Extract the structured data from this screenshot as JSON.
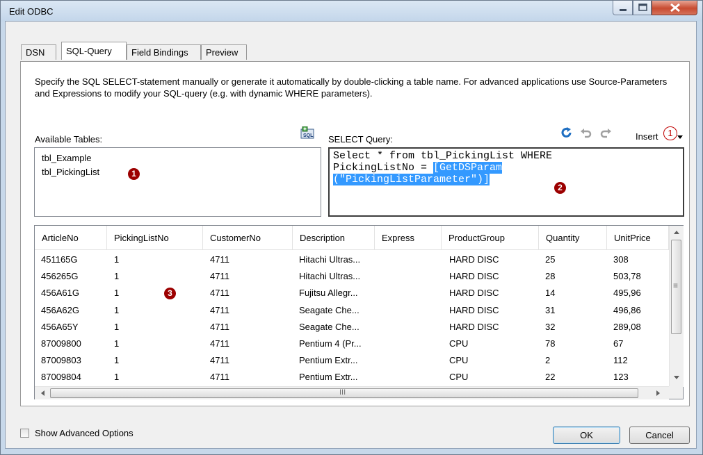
{
  "window": {
    "title": "Edit ODBC"
  },
  "tabs": [
    {
      "label": "DSN"
    },
    {
      "label": "SQL-Query"
    },
    {
      "label": "Field Bindings"
    },
    {
      "label": "Preview"
    }
  ],
  "description": "Specify the SQL SELECT-statement manually or generate it automatically by double-clicking a table name. For advanced applications use Source-Parameters and Expressions to modify your SQL-query (e.g. with dynamic WHERE parameters).",
  "available_tables": {
    "label": "Available Tables:",
    "items": [
      "tbl_Example",
      "tbl_PickingList"
    ]
  },
  "select_query": {
    "label": "SELECT Query:",
    "line1": "Select * from tbl_PickingList WHERE",
    "line2_plain": "PickingListNo = ",
    "line2_highlight": "[GetDSParam",
    "line3_highlight": "(\"PickingListParameter\")]",
    "insert_label": "Insert"
  },
  "markers": {
    "m1": "1",
    "m2": "2",
    "m3": "3",
    "insert_marker": "1"
  },
  "grid": {
    "columns": [
      "ArticleNo",
      "PickingListNo",
      "CustomerNo",
      "Description",
      "Express",
      "ProductGroup",
      "Quantity",
      "UnitPrice"
    ],
    "rows": [
      [
        "451165G",
        "1",
        "4711",
        "Hitachi Ultras...",
        "",
        "HARD DISC",
        "25",
        "308"
      ],
      [
        "456265G",
        "1",
        "4711",
        "Hitachi Ultras...",
        "",
        "HARD DISC",
        "28",
        "503,78"
      ],
      [
        "456A61G",
        "1",
        "4711",
        "Fujitsu Allegr...",
        "",
        "HARD DISC",
        "14",
        "495,96"
      ],
      [
        "456A62G",
        "1",
        "4711",
        "Seagate Che...",
        "",
        "HARD DISC",
        "31",
        "496,86"
      ],
      [
        "456A65Y",
        "1",
        "4711",
        "Seagate Che...",
        "",
        "HARD DISC",
        "32",
        "289,08"
      ],
      [
        "87009800",
        "1",
        "4711",
        "Pentium 4 (Pr...",
        "",
        "CPU",
        "78",
        "67"
      ],
      [
        "87009803",
        "1",
        "4711",
        "Pentium Extr...",
        "",
        "CPU",
        "2",
        "112"
      ],
      [
        "87009804",
        "1",
        "4711",
        "Pentium Extr...",
        "",
        "CPU",
        "22",
        "123"
      ]
    ],
    "hscroll_grip": "III",
    "vscroll_grip": "≡"
  },
  "footer": {
    "show_advanced_label": "Show Advanced Options",
    "ok_label": "OK",
    "cancel_label": "Cancel"
  }
}
